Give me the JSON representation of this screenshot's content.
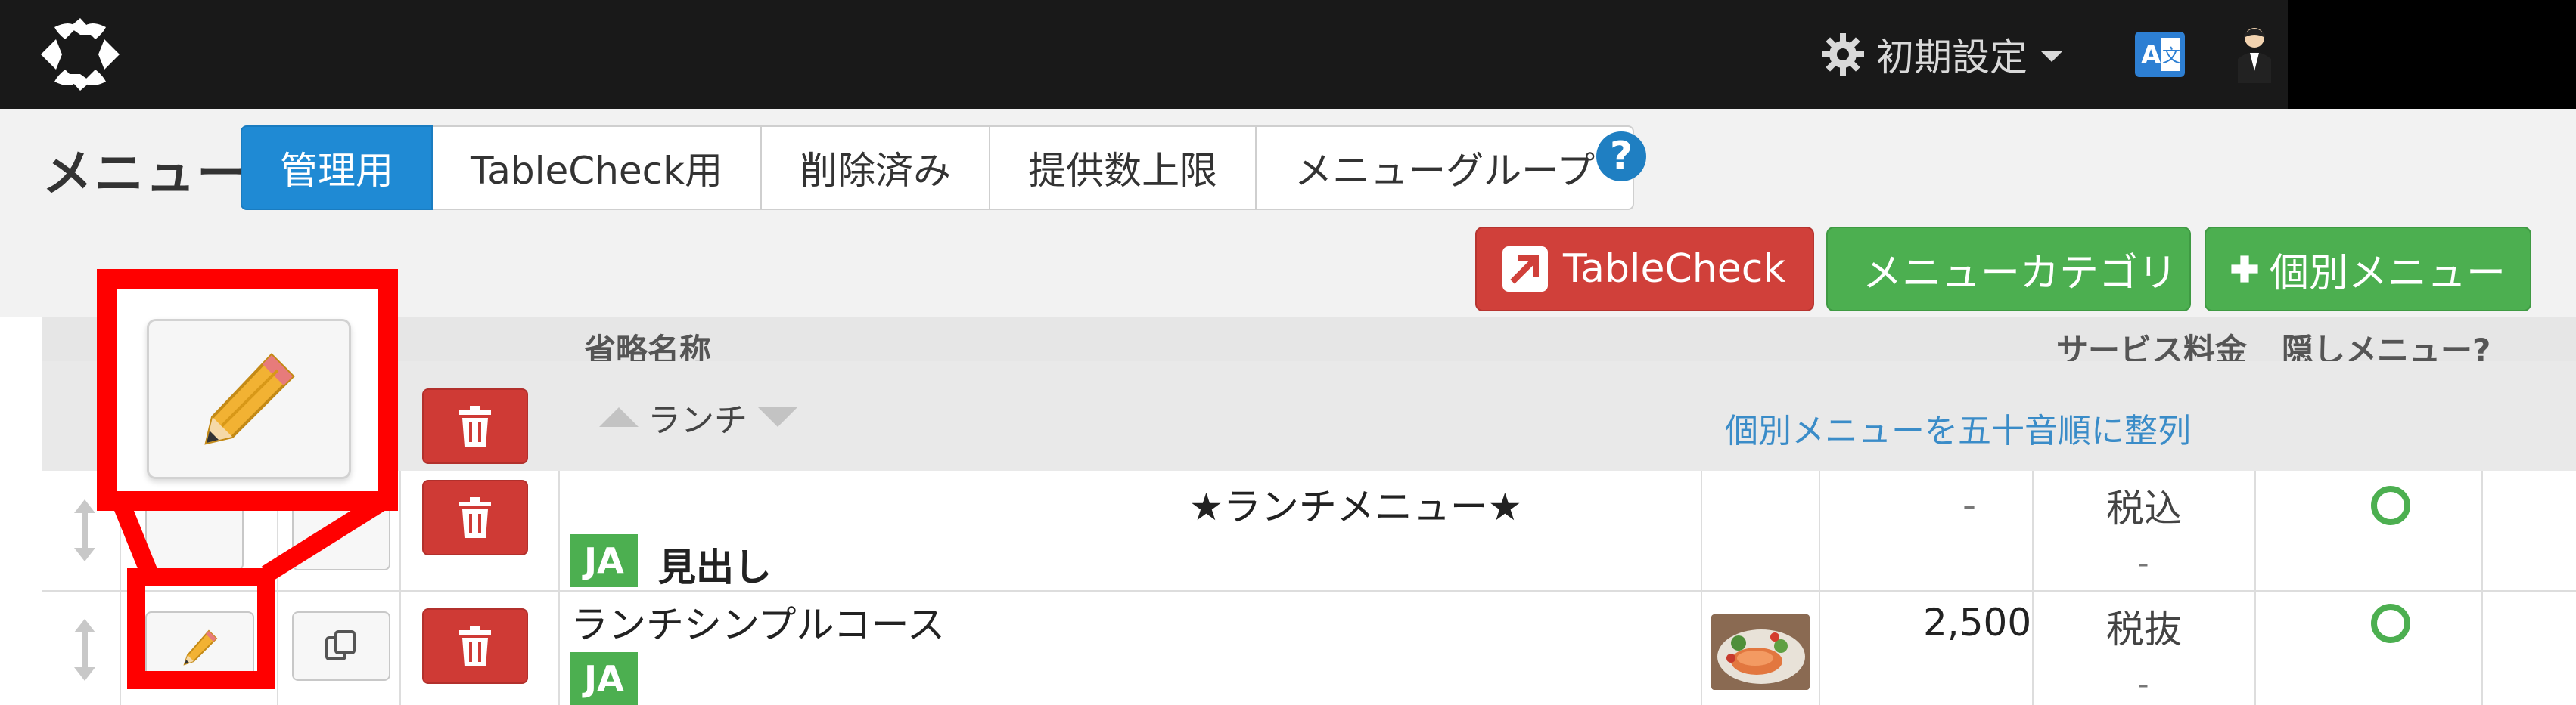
{
  "topbar": {
    "settings_label": "初期設定",
    "translate_icon": "translate-icon",
    "avatar_icon": "user-avatar-icon"
  },
  "page": {
    "title": "メニュー",
    "help_icon": "help-icon",
    "help_label": "?"
  },
  "tabs": [
    {
      "label": "管理用",
      "active": true
    },
    {
      "label": "TableCheck用",
      "active": false
    },
    {
      "label": "削除済み",
      "active": false
    },
    {
      "label": "提供数上限",
      "active": false
    },
    {
      "label": "メニューグループ",
      "active": false
    }
  ],
  "actions": {
    "tablecheck_label": "TableCheck",
    "add_category_label": "メニューカテゴリ",
    "add_item_label": "個別メニュー"
  },
  "table": {
    "headers": {
      "short_name": "省略名称",
      "service_fee": "サービス料金",
      "hidden_menu": "隠しメニュー?"
    },
    "category_filter": "ランチ",
    "sort_link": "個別メニューを五十音順に整列",
    "rows": [
      {
        "title": "★ランチメニュー★",
        "badge": "JA",
        "name": "見出し",
        "price": "-",
        "tax": "税込",
        "tax_sub": "-",
        "hidden": true
      },
      {
        "name": "ランチシンプルコース",
        "badge": "JA",
        "price": "2,500",
        "tax": "税抜",
        "tax_sub": "-",
        "hidden": true,
        "image": "food-thumbnail"
      }
    ]
  },
  "colors": {
    "topbar": "#191919",
    "accent_blue": "#1f8ad4",
    "green": "#4caf50",
    "red": "#d0403a",
    "highlight": "#ff0000"
  }
}
